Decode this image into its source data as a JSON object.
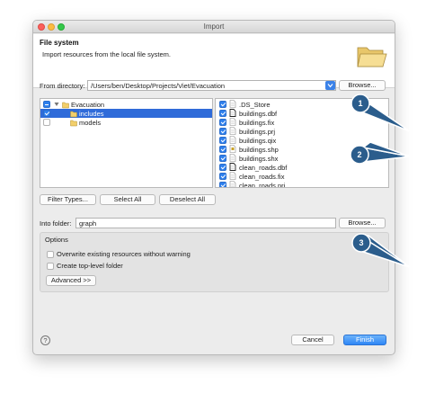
{
  "window": {
    "title": "Import"
  },
  "banner": {
    "title": "File system",
    "description": "Import resources from the local file system."
  },
  "from_directory": {
    "label": "From directory:",
    "value": "/Users/ben/Desktop/Projects/Viet/Evacuation",
    "browse_label": "Browse..."
  },
  "tree": [
    {
      "label": "Evacuation",
      "state": "partial",
      "expanded": true,
      "indent": 0
    },
    {
      "label": "includes",
      "state": "checked",
      "selected": true,
      "indent": 1
    },
    {
      "label": "models",
      "state": "unchecked",
      "indent": 1
    }
  ],
  "files": [
    {
      "name": ".DS_Store",
      "checked": true,
      "icon": "file-icon"
    },
    {
      "name": "buildings.dbf",
      "checked": true,
      "icon": "dbf-file-icon"
    },
    {
      "name": "buildings.fix",
      "checked": true,
      "icon": "file-icon"
    },
    {
      "name": "buildings.prj",
      "checked": true,
      "icon": "file-icon"
    },
    {
      "name": "buildings.qix",
      "checked": true,
      "icon": "file-icon"
    },
    {
      "name": "buildings.shp",
      "checked": true,
      "icon": "shp-file-icon"
    },
    {
      "name": "buildings.shx",
      "checked": true,
      "icon": "file-icon"
    },
    {
      "name": "clean_roads.dbf",
      "checked": true,
      "icon": "dbf-file-icon"
    },
    {
      "name": "clean_roads.fix",
      "checked": true,
      "icon": "file-icon"
    },
    {
      "name": "clean_roads.pri",
      "checked": true,
      "icon": "file-icon"
    }
  ],
  "buttons": {
    "filter_types": "Filter Types...",
    "select_all": "Select All",
    "deselect_all": "Deselect All"
  },
  "into_folder": {
    "label": "Into folder:",
    "value": "graph",
    "browse_label": "Browse..."
  },
  "options": {
    "title": "Options",
    "overwrite": {
      "label": "Overwrite existing resources without warning",
      "checked": false
    },
    "top_level": {
      "label": "Create top-level folder",
      "checked": false
    },
    "advanced_label": "Advanced >>"
  },
  "footer": {
    "help": "?",
    "cancel": "Cancel",
    "finish": "Finish"
  },
  "callouts": [
    "1",
    "2",
    "3"
  ],
  "colors": {
    "accent": "#2f80ed",
    "selection": "#2f6bd9",
    "callout": "#2b5d8c"
  }
}
